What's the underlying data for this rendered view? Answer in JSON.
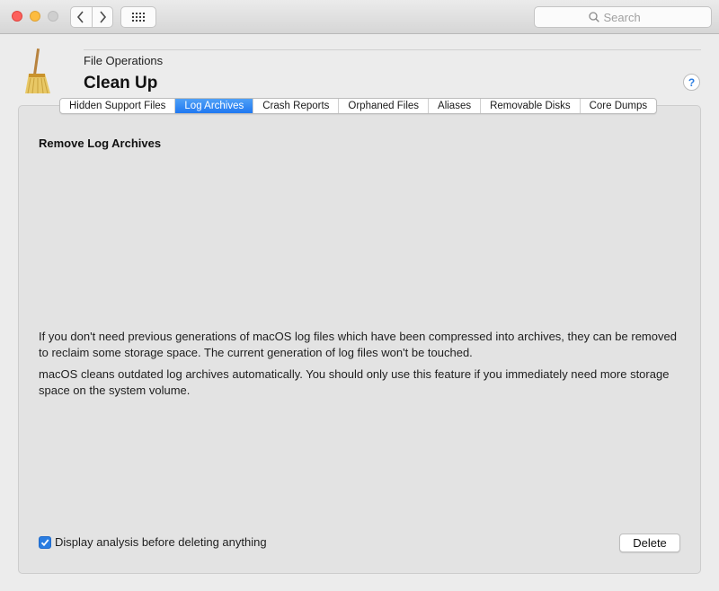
{
  "toolbar": {
    "search_placeholder": "Search",
    "back_icon": "chevron-left-icon",
    "forward_icon": "chevron-right-icon",
    "grid_icon": "grid-icon"
  },
  "header": {
    "subtitle": "File Operations",
    "title": "Clean Up",
    "help_label": "?",
    "icon": "broom-icon"
  },
  "tabs": [
    {
      "label": "Hidden Support Files",
      "active": false
    },
    {
      "label": "Log Archives",
      "active": true
    },
    {
      "label": "Crash Reports",
      "active": false
    },
    {
      "label": "Orphaned Files",
      "active": false
    },
    {
      "label": "Aliases",
      "active": false
    },
    {
      "label": "Removable Disks",
      "active": false
    },
    {
      "label": "Core Dumps",
      "active": false
    }
  ],
  "main": {
    "section_title": "Remove Log Archives",
    "paragraph1": "If you don't need previous generations of macOS log files which have been compressed into archives, they can be removed to reclaim some storage space. The current generation of log files won't be touched.",
    "paragraph2": "macOS cleans outdated log archives automatically. You should only use this feature if you immediately need more storage space on the system volume.",
    "checkbox_label": "Display analysis before deleting anything",
    "checkbox_checked": true,
    "delete_label": "Delete"
  },
  "colors": {
    "accent": "#2a7de1",
    "close": "#fc605c",
    "minimize": "#fdbc40"
  }
}
